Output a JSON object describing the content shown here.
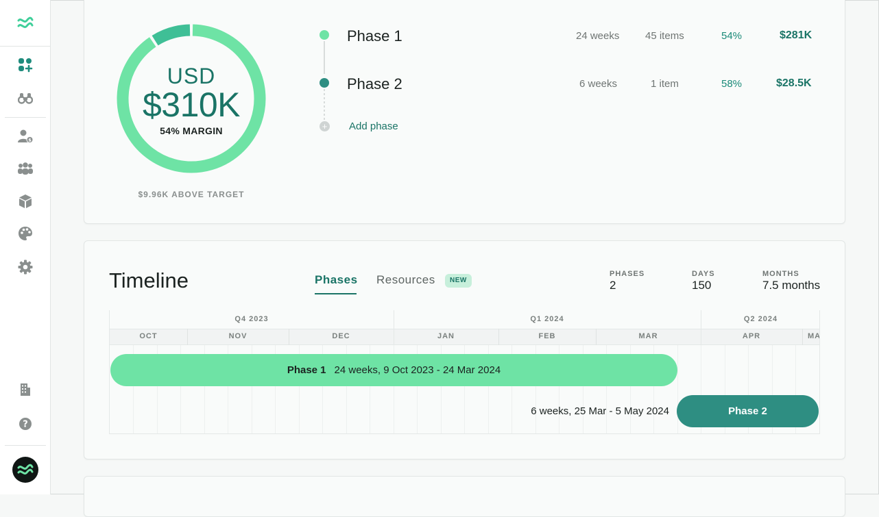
{
  "sidebar": {
    "logo": "wave-logo",
    "items": [
      {
        "name": "dashboard-icon"
      },
      {
        "name": "binoculars-icon"
      },
      {
        "name": "user-billing-icon"
      },
      {
        "name": "team-icon"
      },
      {
        "name": "box-icon"
      },
      {
        "name": "palette-icon"
      },
      {
        "name": "gear-icon"
      }
    ],
    "bottom_items": [
      {
        "name": "building-icon"
      },
      {
        "name": "help-icon"
      }
    ]
  },
  "summary": {
    "currency": "USD",
    "amount": "$310K",
    "margin": "54% MARGIN",
    "margin_fraction": 0.54,
    "above_target": "$9.96K ABOVE TARGET",
    "colors": {
      "primary": "#6ee3a5",
      "secondary": "#3fbf96"
    }
  },
  "phases": [
    {
      "name": "Phase 1",
      "duration": "24 weeks",
      "items": "45 items",
      "margin": "54%",
      "value": "$281K",
      "color": "#6ee3a5"
    },
    {
      "name": "Phase 2",
      "duration": "6 weeks",
      "items": "1 item",
      "margin": "58%",
      "value": "$28.5K",
      "color": "#2e8e82"
    }
  ],
  "add_phase_label": "Add phase",
  "timeline": {
    "title": "Timeline",
    "tabs": {
      "phases": "Phases",
      "resources": "Resources",
      "new_badge": "NEW"
    },
    "stats": {
      "phases_label": "PHASES",
      "phases_value": "2",
      "days_label": "DAYS",
      "days_value": "150",
      "months_label": "MONTHS",
      "months_value": "7.5 months"
    },
    "quarters": [
      "Q4 2023",
      "Q1 2024",
      "Q2 2024"
    ],
    "months": [
      "OCT",
      "NOV",
      "DEC",
      "JAN",
      "FEB",
      "MAR",
      "APR",
      "MA"
    ],
    "bars": [
      {
        "name": "Phase 1",
        "description": "24 weeks, 9 Oct 2023 - 24 Mar 2024"
      },
      {
        "name": "Phase 2",
        "description": "6 weeks, 25 Mar - 5 May 2024"
      }
    ]
  }
}
